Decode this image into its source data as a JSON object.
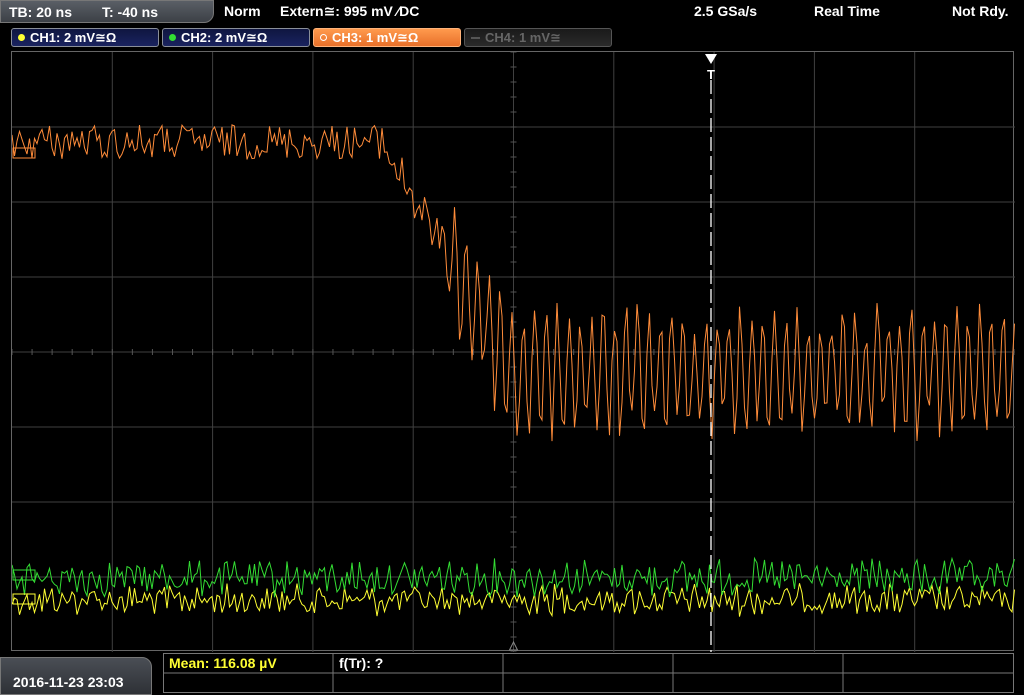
{
  "status_bar": {
    "timebase": "TB: 20 ns",
    "trigger_time": "T: -40 ns",
    "trigger_mode": "Norm",
    "trigger_source": "Extern≅: 995 mV ∕DC",
    "sample_rate": "2.5 GSa/s",
    "acquisition_mode": "Real Time",
    "run_state": "Not Rdy."
  },
  "channels": [
    {
      "label": "CH1: 2 mV≅Ω",
      "color": "#ffff33",
      "active": true
    },
    {
      "label": "CH2: 2 mV≅Ω",
      "color": "#33dd33",
      "active": true
    },
    {
      "label": "CH3: 1 mV≅Ω",
      "color": "#ff8c3a",
      "active": true,
      "selected": true
    },
    {
      "label": "CH4: 1 mV≅",
      "color": "#666666",
      "active": false
    }
  ],
  "trigger_marker": "T",
  "measurement": {
    "mean_label": "Mean: 116.08 µV",
    "rise_label": "f(Tr): ?"
  },
  "timestamp": "2016-11-23 23:03",
  "colors": {
    "ch1": "#ffff33",
    "ch2": "#33dd33",
    "ch3": "#ff8c3a",
    "grid": "#404040",
    "trigger_line": "#ffffff",
    "measure_text": "#ffff33"
  }
}
